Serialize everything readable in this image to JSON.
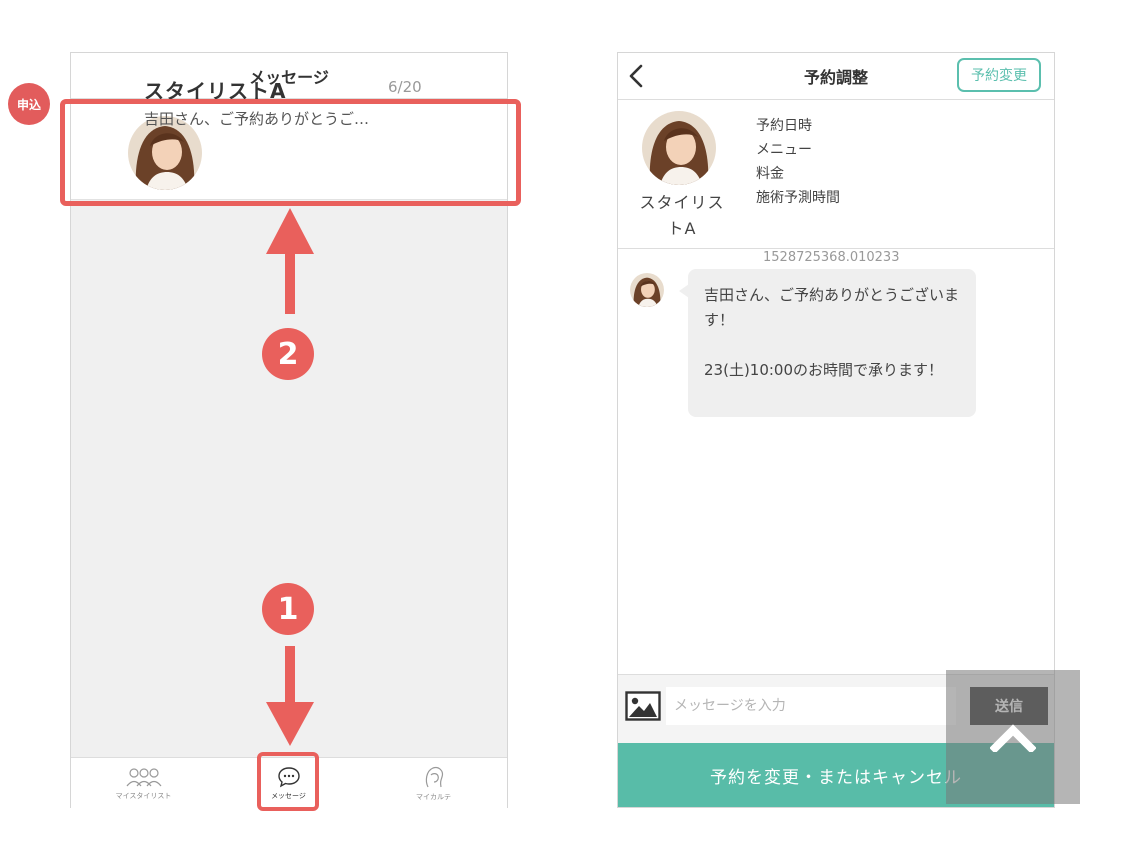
{
  "left_screen": {
    "header_title": "メッセージ",
    "message": {
      "badge": "申込",
      "name": "スタイリストA",
      "date": "6/20",
      "preview": "吉田さん、ご予約ありがとうご…"
    },
    "nav": [
      {
        "label": "マイスタイリスト",
        "icon": "stylists-icon"
      },
      {
        "label": "メッセージ",
        "icon": "chat-bubble-icon"
      },
      {
        "label": "マイカルテ",
        "icon": "profile-head-icon"
      }
    ]
  },
  "annotations": {
    "step_1": "1",
    "step_2": "2",
    "color": "#e9605c"
  },
  "right_screen": {
    "back_icon": "chevron-left-icon",
    "header_title": "予約調整",
    "change_button": "予約変更",
    "stylist_name": "スタイリストA",
    "info_labels": [
      "予約日時",
      "メニュー",
      "料金",
      "施術予測時間"
    ],
    "timestamp": "1528725368.010233",
    "chat_message": "吉田さん、ご予約ありがとうございます！\n\n23(土)10:00のお時間で承ります！",
    "input_placeholder": "メッセージを入力",
    "send_button": "送信",
    "cancel_button": "予約を変更・またはキャンセル",
    "accent_color": "#58bca8"
  }
}
